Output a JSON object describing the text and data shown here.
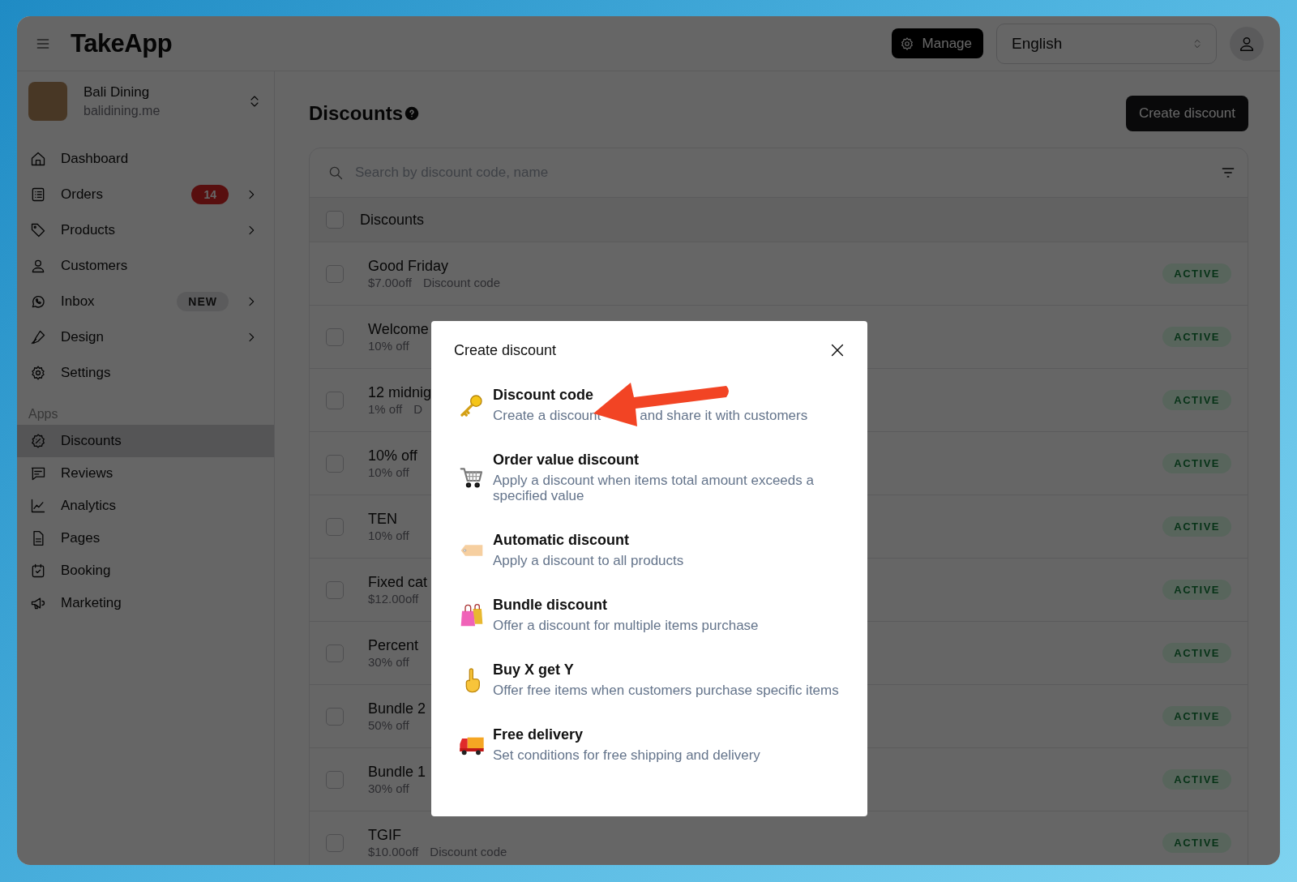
{
  "topbar": {
    "logo": "TakeApp",
    "manage_button": "Manage",
    "language": "English"
  },
  "sidebar": {
    "store": {
      "name": "Bali Dining",
      "domain": "balidining.me"
    },
    "items": [
      {
        "label": "Dashboard",
        "selected": false,
        "expandable": false
      },
      {
        "label": "Orders",
        "selected": false,
        "expandable": true,
        "badge": {
          "text": "14",
          "kind": "count"
        }
      },
      {
        "label": "Products",
        "selected": false,
        "expandable": true
      },
      {
        "label": "Customers",
        "selected": false,
        "expandable": false
      },
      {
        "label": "Inbox",
        "selected": false,
        "expandable": true,
        "badge": {
          "text": "NEW",
          "kind": "new"
        }
      },
      {
        "label": "Design",
        "selected": false,
        "expandable": true
      },
      {
        "label": "Settings",
        "selected": false,
        "expandable": false
      }
    ],
    "apps_label": "Apps",
    "apps": [
      {
        "label": "Discounts",
        "selected": true
      },
      {
        "label": "Reviews",
        "selected": false
      },
      {
        "label": "Analytics",
        "selected": false
      },
      {
        "label": "Pages",
        "selected": false
      },
      {
        "label": "Booking",
        "selected": false
      },
      {
        "label": "Marketing",
        "selected": false
      }
    ]
  },
  "page": {
    "title": "Discounts",
    "create_button": "Create discount",
    "search": {
      "placeholder": "Search by discount code, name"
    },
    "header": {
      "label": "Discounts",
      "checked": false
    },
    "rows": [
      {
        "name": "Good Friday",
        "amount": "$7.00off",
        "type": "Discount code",
        "status": "ACTIVE",
        "checked": false
      },
      {
        "name": "Welcome",
        "amount": "10% off",
        "status": "ACTIVE",
        "checked": false
      },
      {
        "name": "12 midnig",
        "amount": "1% off",
        "type": "D",
        "status": "ACTIVE",
        "checked": false
      },
      {
        "name": "10% off",
        "amount": "10% off",
        "status": "ACTIVE",
        "checked": false
      },
      {
        "name": "TEN",
        "amount": "10% off",
        "status": "ACTIVE",
        "checked": false
      },
      {
        "name": "Fixed cat",
        "amount": "$12.00off",
        "status": "ACTIVE",
        "checked": false
      },
      {
        "name": "Percent",
        "amount": "30% off",
        "status": "ACTIVE",
        "checked": false
      },
      {
        "name": "Bundle 2",
        "amount": "50% off",
        "status": "ACTIVE",
        "checked": false
      },
      {
        "name": "Bundle 1",
        "amount": "30% off",
        "status": "ACTIVE",
        "checked": false
      },
      {
        "name": "TGIF",
        "amount": "$10.00off",
        "type": "Discount code",
        "status": "ACTIVE",
        "checked": false
      }
    ]
  },
  "modal": {
    "title": "Create discount",
    "options": [
      {
        "title": "Discount code",
        "description_parts": [
          "Create a discount",
          "and share it with customers"
        ]
      },
      {
        "title": "Order value discount",
        "description": "Apply a discount when items total amount exceeds a specified value"
      },
      {
        "title": "Automatic discount",
        "description": "Apply a discount to all products"
      },
      {
        "title": "Bundle discount",
        "description": "Offer a discount for multiple items purchase"
      },
      {
        "title": "Buy X get Y",
        "description": "Offer free items when customers purchase specific items"
      },
      {
        "title": "Free delivery",
        "description": "Set conditions for free shipping and delivery"
      }
    ]
  }
}
